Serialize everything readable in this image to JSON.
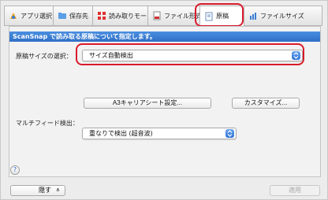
{
  "tabs": [
    {
      "label": "アプリ選択",
      "icon": "app-select-icon"
    },
    {
      "label": "保存先",
      "icon": "folder-icon"
    },
    {
      "label": "読み取りモード",
      "icon": "scan-mode-icon"
    },
    {
      "label": "ファイル形式",
      "icon": "file-format-icon"
    },
    {
      "label": "原稿",
      "icon": "document-icon"
    },
    {
      "label": "ファイルサイズ",
      "icon": "file-size-icon"
    }
  ],
  "active_tab": "原稿",
  "panel": {
    "banner": "ScanSnap で読み取る原稿について指定します。",
    "paper_size": {
      "label": "原稿サイズの選択：",
      "value": "サイズ自動検出"
    },
    "a3_carrier_button": "A3キャリアシート設定...",
    "customize_button": "カスタマイズ...",
    "multifeed": {
      "label": "マルチフィード検出：",
      "value": "重なりで検出 (超音波)"
    }
  },
  "help_label": "?",
  "footer": {
    "hide_button": "隠す",
    "hide_caret": "∧",
    "apply_button": "適用"
  },
  "colors": {
    "highlight_ring": "#d91b2c",
    "banner": "#3b7ed6",
    "select_arrow": "#2f72d4"
  }
}
